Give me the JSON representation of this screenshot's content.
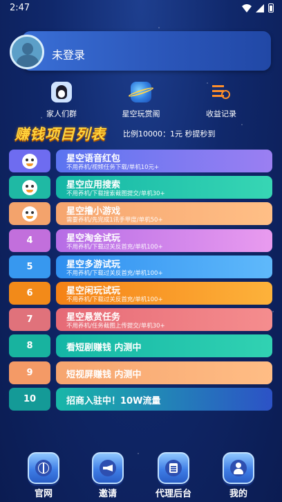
{
  "status_bar": {
    "time": "2:47"
  },
  "user": {
    "login_label": "未登录"
  },
  "quick_links": [
    {
      "label": "家人们群",
      "icon": "penguin-icon"
    },
    {
      "label": "星空玩赏阁",
      "icon": "planet-icon"
    },
    {
      "label": "收益记录",
      "icon": "ledger-clock-icon"
    }
  ],
  "section": {
    "title": "赚钱项目列表",
    "note": "比例10000：1元 秒提秒到"
  },
  "projects": [
    {
      "badge": "",
      "title": "星空语音红包",
      "desc": "不用养机/视频任务下载/单机10元+",
      "badge_color": "#6e6cf0",
      "colors": [
        "#5b74f0",
        "#9b7ff2"
      ]
    },
    {
      "badge": "",
      "title": "星空应用搜索",
      "desc": "不用养机/下载搜索截图提交/单机30+",
      "badge_color": "#1fb9a4",
      "colors": [
        "#14b6a6",
        "#37d6b4"
      ]
    },
    {
      "badge": "",
      "title": "星空撸小游戏",
      "desc": "需要养机/先完成1讯手甲度/单机50+",
      "badge_color": "#f3a36c",
      "colors": [
        "#f6a56f",
        "#ffbf86"
      ]
    },
    {
      "badge": "4",
      "title": "星空淘金试玩",
      "desc": "不用养机/下载过关反首充/单机100+",
      "badge_color": "#c26fdc",
      "colors": [
        "#b66de6",
        "#e99bef"
      ]
    },
    {
      "badge": "5",
      "title": "星空多游试玩",
      "desc": "不用养机/下载过关反首充/单机100+",
      "badge_color": "#3798ef",
      "colors": [
        "#2f8ff0",
        "#5fb9fb"
      ]
    },
    {
      "badge": "6",
      "title": "星空闲玩试玩",
      "desc": "不用养机/下载过关反首充/单机100+",
      "badge_color": "#f28a19",
      "colors": [
        "#f58216",
        "#fdb23b"
      ]
    },
    {
      "badge": "7",
      "title": "星空悬赏任务",
      "desc": "不用养机/任务截图上传提交/单机30+",
      "badge_color": "#e0727b",
      "colors": [
        "#e66a76",
        "#f58d8e"
      ]
    },
    {
      "badge": "8",
      "title": "看短剧赚钱  内测中",
      "desc": "",
      "badge_color": "#18b39f",
      "colors": [
        "#14b6a6",
        "#31d2b2"
      ]
    },
    {
      "badge": "9",
      "title": "短视屏赚钱  内测中",
      "desc": "",
      "badge_color": "#f49a66",
      "colors": [
        "#f6a56f",
        "#ffbd85"
      ]
    },
    {
      "badge": "10",
      "title": "招商入驻中！10W流量",
      "desc": "",
      "badge_color": "#149a97",
      "colors": [
        "#18b7a8",
        "#2c52c6"
      ]
    }
  ],
  "bottom_nav": [
    {
      "label": "官网",
      "icon": "globe-icon"
    },
    {
      "label": "邀请",
      "icon": "megaphone-icon"
    },
    {
      "label": "代理后台",
      "icon": "document-icon"
    },
    {
      "label": "我的",
      "icon": "user-icon"
    }
  ]
}
